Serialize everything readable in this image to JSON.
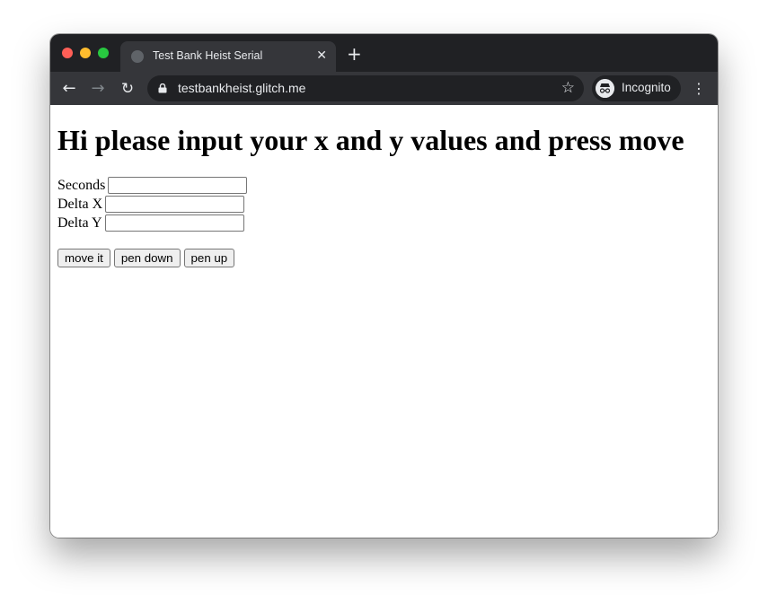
{
  "browser": {
    "tab_title": "Test Bank Heist Serial",
    "tab_close": "✕",
    "new_tab": "+",
    "url": "testbankheist.glitch.me",
    "profile_label": "Incognito",
    "nav": {
      "back": "←",
      "forward": "→",
      "reload": "↻",
      "star": "☆",
      "menu": "⋮"
    },
    "icons": {
      "favicon": "globe-icon",
      "lock": "lock-icon",
      "profile": "incognito-icon"
    },
    "colors": {
      "tabstrip": "#202124",
      "toolbar": "#35363a"
    }
  },
  "page": {
    "heading": "Hi please input your x and y values and press move",
    "fields": [
      {
        "label": "Seconds",
        "value": ""
      },
      {
        "label": "Delta X",
        "value": ""
      },
      {
        "label": "Delta Y",
        "value": ""
      }
    ],
    "buttons": {
      "move": "move it",
      "pen_down": "pen down",
      "pen_up": "pen up"
    }
  }
}
